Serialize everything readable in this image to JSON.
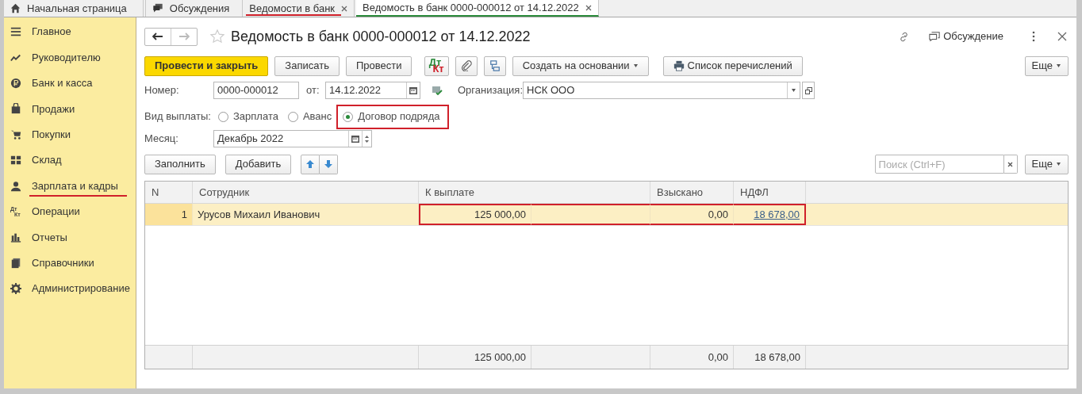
{
  "tabs": [
    {
      "label": "Начальная страница",
      "selected": false,
      "closable": false,
      "highlighted": false
    },
    {
      "label": "Обсуждения",
      "selected": false,
      "closable": false,
      "highlighted": false
    },
    {
      "label": "Ведомости в банк",
      "selected": false,
      "closable": true,
      "highlighted": true
    },
    {
      "label": "Ведомость в банк 0000-000012 от 14.12.2022",
      "selected": true,
      "closable": true,
      "highlighted": false
    }
  ],
  "sidebar": {
    "items": [
      {
        "label": "Главное",
        "highlighted": false
      },
      {
        "label": "Руководителю",
        "highlighted": false
      },
      {
        "label": "Банк и касса",
        "highlighted": false
      },
      {
        "label": "Продажи",
        "highlighted": false
      },
      {
        "label": "Покупки",
        "highlighted": false
      },
      {
        "label": "Склад",
        "highlighted": false
      },
      {
        "label": "Зарплата и кадры",
        "highlighted": true
      },
      {
        "label": "Операции",
        "highlighted": false,
        "icon_text": [
          "Дт",
          "Кт"
        ]
      },
      {
        "label": "Отчеты",
        "highlighted": false
      },
      {
        "label": "Справочники",
        "highlighted": false
      },
      {
        "label": "Администрирование",
        "highlighted": false
      }
    ]
  },
  "form": {
    "title": "Ведомость в банк 0000-000012 от 14.12.2022",
    "discussion": "Обсуждение",
    "toolbar": [
      {
        "kind": "primary",
        "label": "Провести и закрыть"
      },
      {
        "kind": "button",
        "label": "Записать"
      },
      {
        "kind": "button",
        "label": "Провести"
      },
      {
        "kind": "dtkt",
        "icon_text": [
          "Дт",
          "Кт"
        ]
      },
      {
        "kind": "clip"
      },
      {
        "kind": "structure"
      },
      {
        "kind": "dropdown",
        "label": "Создать на основании"
      },
      {
        "kind": "print",
        "label": "Список перечислений"
      }
    ],
    "more": "Еще",
    "number_label": "Номер:",
    "number": "0000-000012",
    "date_label": "от:",
    "date": "14.12.2022",
    "org_label": "Организация:",
    "org": "НСК ООО",
    "payment_label": "Вид выплаты:",
    "payment_highlighted": true,
    "payment_options": [
      {
        "label": "Зарплата",
        "selected": false
      },
      {
        "label": "Аванс",
        "selected": false
      },
      {
        "label": "Договор подряда",
        "selected": true
      }
    ],
    "month_label": "Месяц:",
    "month": "Декабрь 2022",
    "table_buttons": [
      "Заполнить",
      "Добавить"
    ],
    "search": {
      "placeholder": "Поиск (Ctrl+F)"
    },
    "table_more": "Еще",
    "table": {
      "columns": [
        "N",
        "Сотрудник",
        "К выплате",
        "Взыскано",
        "НДФЛ"
      ],
      "rows": [
        {
          "selected": true,
          "cells": [
            {
              "text": "1",
              "kind": "number",
              "highlighted": false
            },
            {
              "text": "Урусов Михаил Иванович",
              "kind": "text",
              "highlighted": false
            },
            {
              "text": "125 000,00",
              "kind": "number",
              "highlighted": true
            },
            {
              "text": "0,00",
              "kind": "number",
              "highlighted": true
            },
            {
              "text": "18 678,00",
              "kind": "link",
              "highlighted": true
            }
          ]
        }
      ],
      "totals": [
        "125 000,00",
        "0,00",
        "18 678,00"
      ]
    }
  }
}
